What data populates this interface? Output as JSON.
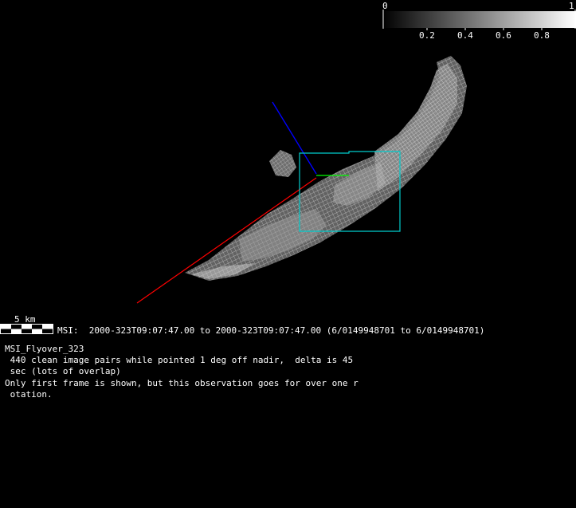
{
  "colorbar": {
    "label_min": "0",
    "label_max": "1",
    "ticks": [
      "0.2",
      "0.4",
      "0.6",
      "0.8"
    ]
  },
  "scale": {
    "label": "5 km"
  },
  "info": {
    "msi_line": "MSI:  2000-323T09:07:47.00 to 2000-323T09:07:47.00 (6/0149948701 to 6/0149948701)",
    "title": "MSI_Flyover_323",
    "description_lines": [
      " 440 clean image pairs while pointed 1 deg off nadir,  delta is 45",
      " sec (lots of overlap)",
      "Only first frame is shown, but this observation goes for over one r",
      " otation."
    ]
  },
  "colors": {
    "background": "#000000",
    "red_axis": "#ff0000",
    "blue_axis": "#0000ff",
    "green_axis": "#00ff00",
    "footprint": "#00cccc"
  }
}
